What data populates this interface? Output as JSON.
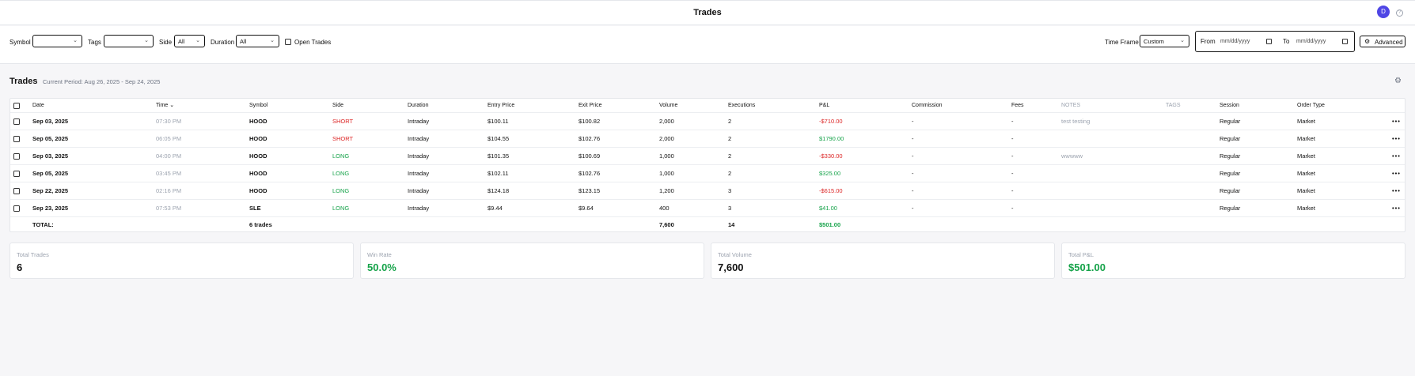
{
  "header": {
    "title": "Trades",
    "avatar_initial": "D",
    "help_icon": "help-circle-icon"
  },
  "filters": {
    "symbol_label": "Symbol",
    "symbol_value": "",
    "tags_label": "Tags",
    "tags_value": "",
    "side_label": "Side",
    "side_value": "All",
    "duration_label": "Duration",
    "duration_value": "All",
    "open_trades_label": "Open Trades",
    "time_frame_label": "Time Frame",
    "time_frame_value": "Custom",
    "from_label": "From",
    "from_placeholder": "mm/dd/yyyy",
    "to_label": "To",
    "to_placeholder": "mm/dd/yyyy",
    "advanced_label": "Advanced"
  },
  "section": {
    "title": "Trades",
    "period": "Current Period: Aug 26, 2025 - Sep 24, 2025"
  },
  "table": {
    "columns": [
      "Date",
      "Time",
      "Symbol",
      "Side",
      "Duration",
      "Entry Price",
      "Exit Price",
      "Volume",
      "Executions",
      "P&L",
      "Commission",
      "Fees",
      "NOTES",
      "TAGS",
      "Session",
      "Order Type"
    ],
    "rows": [
      {
        "date": "Sep 03, 2025",
        "time": "07:30 PM",
        "symbol": "HOOD",
        "side": "SHORT",
        "duration": "Intraday",
        "entry": "$100.11",
        "exit": "$100.82",
        "volume": "2,000",
        "executions": "2",
        "pnl": "-$710.00",
        "commission": "-",
        "fees": "-",
        "notes": "test testing",
        "tags": "",
        "session": "Regular",
        "order_type": "Market"
      },
      {
        "date": "Sep 05, 2025",
        "time": "06:05 PM",
        "symbol": "HOOD",
        "side": "SHORT",
        "duration": "Intraday",
        "entry": "$104.55",
        "exit": "$102.76",
        "volume": "2,000",
        "executions": "2",
        "pnl": "$1790.00",
        "commission": "-",
        "fees": "-",
        "notes": "",
        "tags": "",
        "session": "Regular",
        "order_type": "Market"
      },
      {
        "date": "Sep 03, 2025",
        "time": "04:00 PM",
        "symbol": "HOOD",
        "side": "LONG",
        "duration": "Intraday",
        "entry": "$101.35",
        "exit": "$100.69",
        "volume": "1,000",
        "executions": "2",
        "pnl": "-$330.00",
        "commission": "-",
        "fees": "-",
        "notes": "wwwww",
        "tags": "",
        "session": "Regular",
        "order_type": "Market"
      },
      {
        "date": "Sep 05, 2025",
        "time": "03:45 PM",
        "symbol": "HOOD",
        "side": "LONG",
        "duration": "Intraday",
        "entry": "$102.11",
        "exit": "$102.76",
        "volume": "1,000",
        "executions": "2",
        "pnl": "$325.00",
        "commission": "-",
        "fees": "-",
        "notes": "",
        "tags": "",
        "session": "Regular",
        "order_type": "Market"
      },
      {
        "date": "Sep 22, 2025",
        "time": "02:16 PM",
        "symbol": "HOOD",
        "side": "LONG",
        "duration": "Intraday",
        "entry": "$124.18",
        "exit": "$123.15",
        "volume": "1,200",
        "executions": "3",
        "pnl": "-$615.00",
        "commission": "-",
        "fees": "-",
        "notes": "",
        "tags": "",
        "session": "Regular",
        "order_type": "Market"
      },
      {
        "date": "Sep 23, 2025",
        "time": "07:53 PM",
        "symbol": "SLE",
        "side": "LONG",
        "duration": "Intraday",
        "entry": "$9.44",
        "exit": "$9.64",
        "volume": "400",
        "executions": "3",
        "pnl": "$41.00",
        "commission": "-",
        "fees": "-",
        "notes": "",
        "tags": "",
        "session": "Regular",
        "order_type": "Market"
      }
    ],
    "totals": {
      "label": "TOTAL:",
      "trades": "6 trades",
      "volume": "7,600",
      "executions": "14",
      "pnl": "$501.00"
    },
    "row_menu": "•••",
    "colors": {
      "negative": "#dc2626",
      "positive": "#16a34a"
    }
  },
  "stats": [
    {
      "label": "Total Trades",
      "value": "6"
    },
    {
      "label": "Win Rate",
      "value": "50.0%"
    },
    {
      "label": "Total Volume",
      "value": "7,600"
    },
    {
      "label": "Total P&L",
      "value": "$501.00"
    }
  ]
}
